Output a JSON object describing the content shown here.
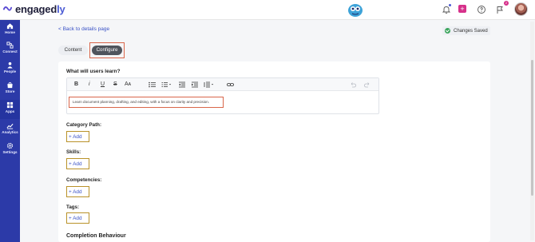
{
  "brand": {
    "name_prefix": "engaged",
    "name_suffix": "ly"
  },
  "header": {
    "notification_count": "2"
  },
  "sidebar": {
    "items": [
      {
        "label": "Home",
        "icon": "home-icon"
      },
      {
        "label": "Connect",
        "icon": "connect-icon"
      },
      {
        "label": "People",
        "icon": "people-icon"
      },
      {
        "label": "Store",
        "icon": "store-icon"
      },
      {
        "label": "Apps",
        "icon": "apps-icon",
        "active": true
      },
      {
        "label": "Analytics",
        "icon": "analytics-icon"
      },
      {
        "label": "Settings",
        "icon": "settings-icon"
      }
    ]
  },
  "page": {
    "back_link": "< Back to details page",
    "save_status": "Changes Saved",
    "tabs": [
      {
        "label": "Content"
      },
      {
        "label": "Configure",
        "selected": true
      }
    ]
  },
  "form": {
    "question_label": "What will users learn?",
    "editor_text": "Learn document planning, drafting, and editing, with a focus on clarity and precision.",
    "toolbar": [
      "B",
      "i",
      "U",
      "S",
      "Aᴀ",
      "bullet-list",
      "numbered-list",
      "outdent",
      "indent",
      "line-height",
      "link",
      "undo",
      "redo"
    ],
    "sections": [
      {
        "label": "Category Path:",
        "button": "+ Add"
      },
      {
        "label": "Skills:",
        "button": "+ Add"
      },
      {
        "label": "Competencies:",
        "button": "+ Add"
      },
      {
        "label": "Tags:",
        "button": "+ Add"
      }
    ],
    "completion_heading": "Completion Behaviour"
  },
  "colors": {
    "sidebar": "#2c3aa8",
    "accent": "#3a52c6",
    "highlight_outline": "#d9664a",
    "add_outline": "#b9922a",
    "success": "#3aa55c"
  }
}
